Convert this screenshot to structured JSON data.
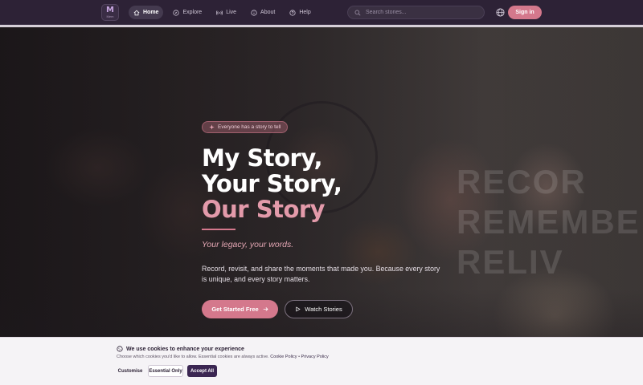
{
  "brand": {
    "logo_glyph": "M",
    "logo_wordmark": "Mem",
    "accent_color": "#d4788c",
    "nav_bg": "#2d2236"
  },
  "nav": {
    "items": [
      {
        "label": "Home",
        "icon": "home-icon",
        "active": true
      },
      {
        "label": "Explore",
        "icon": "compass-icon",
        "active": false
      },
      {
        "label": "Live",
        "icon": "broadcast-icon",
        "active": false
      },
      {
        "label": "About",
        "icon": "info-icon",
        "active": false
      },
      {
        "label": "Help",
        "icon": "help-icon",
        "active": false
      }
    ]
  },
  "search": {
    "placeholder": "Search stories..."
  },
  "header": {
    "sign_in_label": "Sign in",
    "language_icon": "globe-icon"
  },
  "hero": {
    "badge": "Everyone has a story to tell",
    "title_line1": "My Story,",
    "title_line2": "Your Story,",
    "title_line3": "Our Story",
    "subtitle": "Your legacy, your words.",
    "description": "Record, revisit, and share the moments that made you. Because every story is unique, and every story matters.",
    "primary_cta": "Get Started Free",
    "secondary_cta": "Watch Stories",
    "background_words": [
      "RECOR",
      "REMEMBE",
      "RELIV"
    ]
  },
  "cookie": {
    "title": "We use cookies to enhance your experience",
    "text": "Choose which cookies you'd like to allow. Essential cookies are always active.",
    "cookie_policy": "Cookie Policy",
    "separator": "•",
    "privacy_policy": "Privacy Policy",
    "customise": "Customise",
    "essential_only": "Essential Only",
    "accept_all": "Accept All"
  }
}
